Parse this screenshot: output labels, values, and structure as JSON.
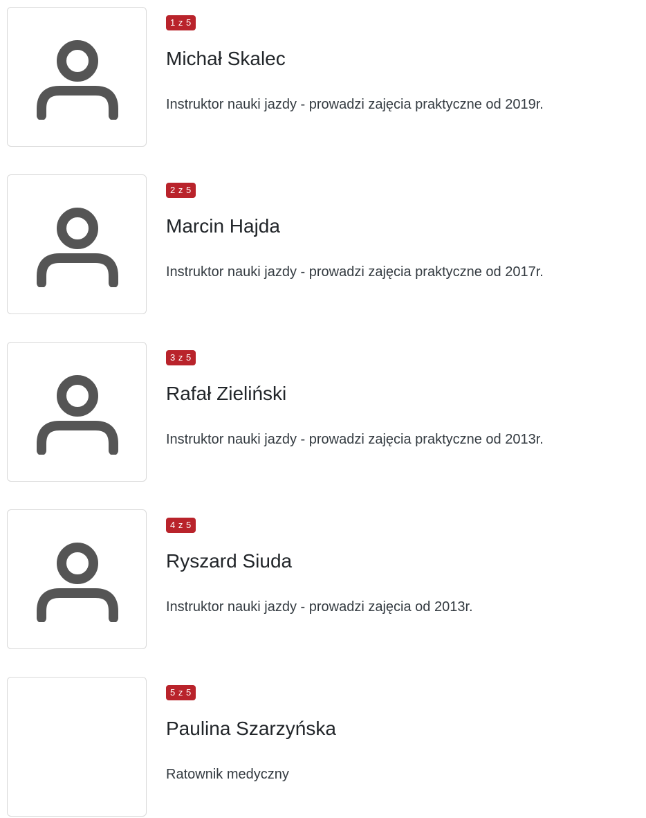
{
  "instructors": [
    {
      "counter": "1 z 5",
      "name": "Michał Skalec",
      "description": "Instruktor nauki jazdy - prowadzi zajęcia praktyczne od 2019r.",
      "avatar_icon": "user-icon"
    },
    {
      "counter": "2 z 5",
      "name": "Marcin Hajda",
      "description": "Instruktor nauki jazdy - prowadzi zajęcia praktyczne od 2017r.",
      "avatar_icon": "user-icon"
    },
    {
      "counter": "3 z 5",
      "name": "Rafał Zieliński",
      "description": "Instruktor nauki jazdy - prowadzi zajęcia praktyczne od 2013r.",
      "avatar_icon": "user-icon"
    },
    {
      "counter": "4 z 5",
      "name": "Ryszard Siuda",
      "description": "Instruktor nauki jazdy - prowadzi zajęcia od 2013r.",
      "avatar_icon": "user-icon"
    },
    {
      "counter": "5 z 5",
      "name": "Paulina Szarzyńska",
      "description": "Ratownik medyczny",
      "avatar_icon": ""
    }
  ],
  "colors": {
    "badge_background": "#b9232b",
    "icon": "#555555",
    "border": "#d9d9d9"
  }
}
